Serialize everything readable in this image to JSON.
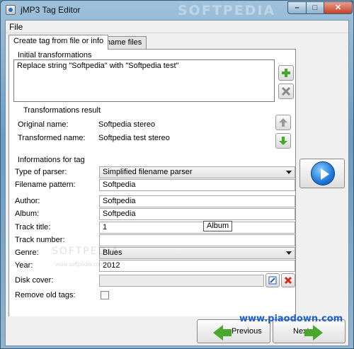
{
  "window": {
    "title": "jMP3 Tag Editor",
    "watermark": "SOFTPEDIA",
    "controls": {
      "minimize": "–",
      "maximize": "□",
      "close": "✕"
    }
  },
  "menu": {
    "file": "File"
  },
  "tabs": [
    {
      "label": "Create tag from file or info",
      "active": true
    },
    {
      "label": "Rename files",
      "active": false
    }
  ],
  "initial_transformations": {
    "title": "Initial transformations",
    "entry": "Replace string \"Softpedia\" with \"Softpedia test\"",
    "add_icon": "plus-icon",
    "remove_icon": "x-icon"
  },
  "transformations_result": {
    "title": "Transformations result",
    "original_label": "Original name:",
    "original_value": "Softpedia stereo",
    "transformed_label": "Transformed name:",
    "transformed_value": "Softpedia test stereo"
  },
  "info": {
    "title": "Informations for tag",
    "parser_label": "Type of parser:",
    "parser_value": "Simplified filename parser",
    "pattern_label": "Filename pattern:",
    "pattern_value": "Softpedia",
    "author_label": "Author:",
    "author_value": "Softpedia",
    "album_label": "Album:",
    "album_value": "Softpedia",
    "track_title_label": "Track title:",
    "track_title_value": "1",
    "track_number_label": "Track number:",
    "track_number_value": "",
    "genre_label": "Genre:",
    "genre_value": "Blues",
    "year_label": "Year:",
    "year_value": "2012",
    "disk_cover_label": "Disk cover:",
    "disk_cover_value": "",
    "remove_old_label": "Remove old tags:",
    "remove_old_checked": false,
    "tooltip": "Album"
  },
  "watermarks": {
    "mid": "SOFTPEDIA",
    "url": "www.softpedia.com"
  },
  "buttons": {
    "previous": "Previous",
    "next": "Next"
  },
  "brand": "www.piaodown.com",
  "colors": {
    "accent_green": "#4aa72e",
    "accent_blue": "#1e78d8",
    "brand_blue": "#1e5fd0"
  }
}
